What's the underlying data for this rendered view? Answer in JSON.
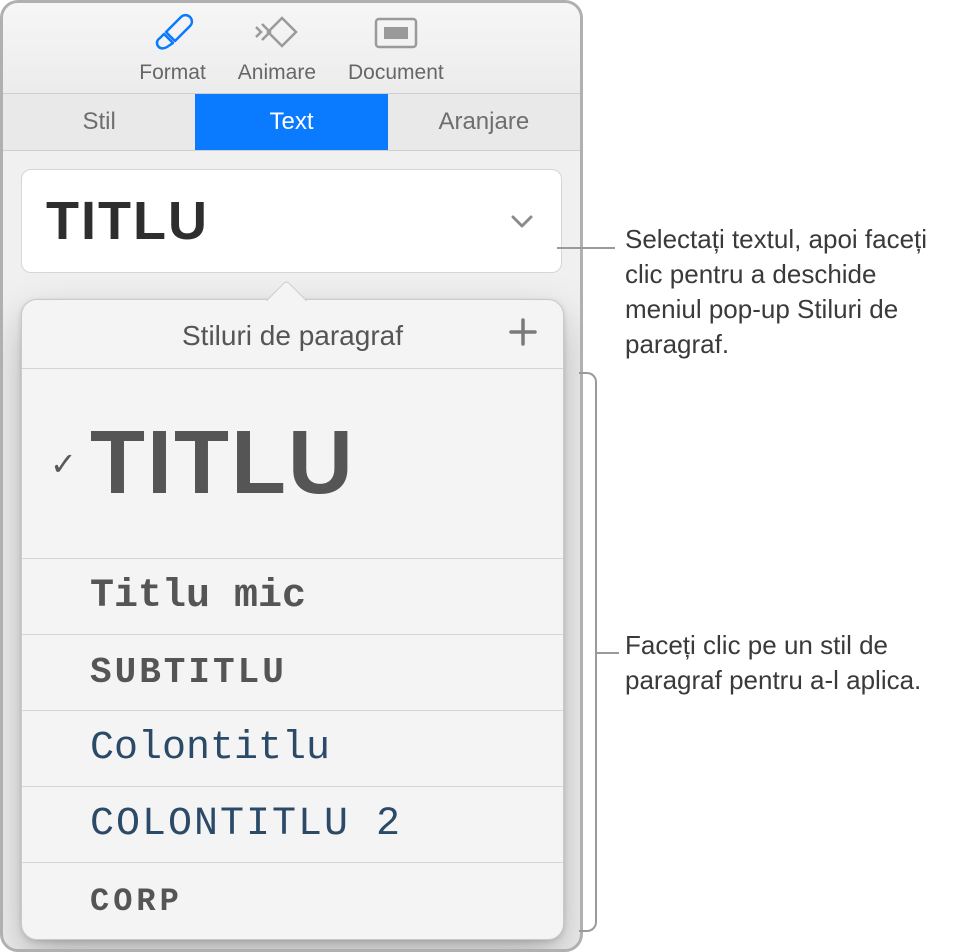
{
  "toolbar": {
    "format": "Format",
    "animate": "Animare",
    "document": "Document"
  },
  "tabs": {
    "style": "Stil",
    "text": "Text",
    "arrange": "Aranjare"
  },
  "currentStyle": "TITLU",
  "popover": {
    "title": "Stiluri de paragraf"
  },
  "styles": {
    "titlu": "TITLU",
    "titlu_mic": "Titlu mic",
    "subtitlu": "SUBTITLU",
    "colontitlu": "Colontitlu",
    "colontitlu2": "COLONTITLU 2",
    "corp": "CORP"
  },
  "callouts": {
    "c1": "Selectați textul, apoi faceți clic pentru a deschide meniul pop-up Stiluri de paragraf.",
    "c2": "Faceți clic pe un stil de paragraf pentru a‑l aplica."
  }
}
